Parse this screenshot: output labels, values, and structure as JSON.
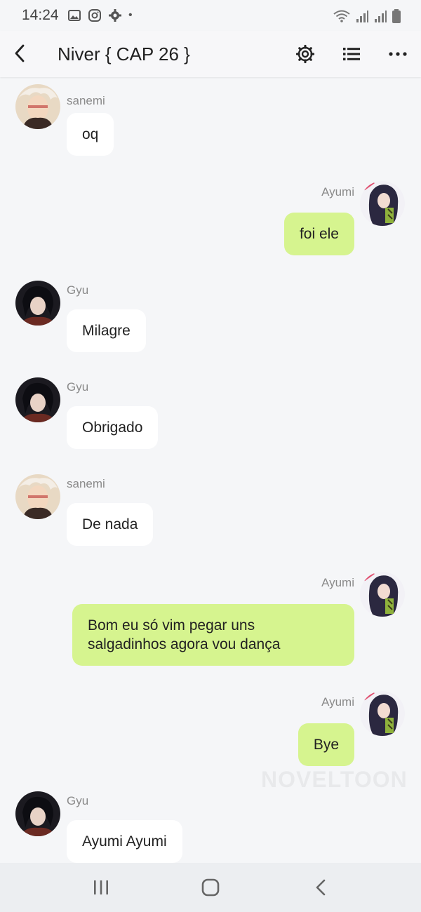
{
  "status_bar": {
    "time": "14:24",
    "dot": "•"
  },
  "header": {
    "title": "Niver { CAP 26 }"
  },
  "colors": {
    "outgoing_bubble": "#d6f48f",
    "incoming_bubble": "#ffffff",
    "background": "#f5f6f8"
  },
  "messages": [
    {
      "sender": "sanemi",
      "text": "oq",
      "direction": "incoming"
    },
    {
      "sender": "Ayumi",
      "text": "foi ele",
      "direction": "outgoing"
    },
    {
      "sender": "Gyu",
      "text": "Milagre",
      "direction": "incoming"
    },
    {
      "sender": "Gyu",
      "text": "Obrigado",
      "direction": "incoming"
    },
    {
      "sender": "sanemi",
      "text": "De nada",
      "direction": "incoming"
    },
    {
      "sender": "Ayumi",
      "text_line1": "Bom eu só vim pegar uns",
      "text_line2": "salgadinhos agora vou dança",
      "direction": "outgoing"
    },
    {
      "sender": "Ayumi",
      "text": "Bye",
      "direction": "outgoing"
    },
    {
      "sender": "Gyu",
      "text": "Ayumi Ayumi",
      "direction": "incoming"
    }
  ],
  "watermark": "NOVELTOON"
}
